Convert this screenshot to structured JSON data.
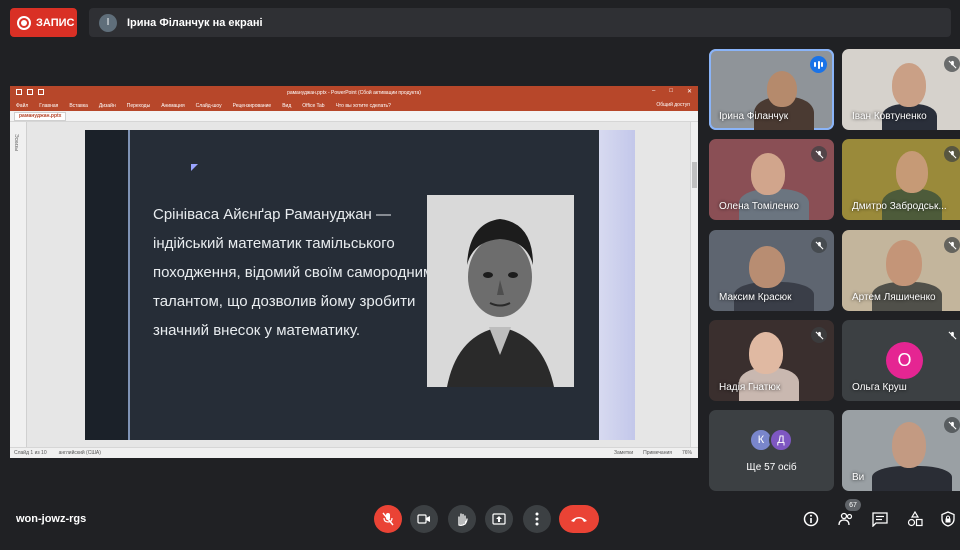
{
  "top": {
    "record_label": "ЗАПИС",
    "presenter_initial": "І",
    "presenting_text": "Ірина Філанчук на екрані"
  },
  "ppt": {
    "window_title": "рамануджан.pptx - PowerPoint (Сбой активации продукта)",
    "menu": [
      "Файл",
      "Главная",
      "Вставка",
      "Дизайн",
      "Переходы",
      "Анимация",
      "Слайд-шоу",
      "Рецензирование",
      "Вид",
      "Office Tab",
      "Что вы хотите сделать?"
    ],
    "share_label": "Общий доступ",
    "file_tab": "рамануджан.pptx",
    "side_label": "Эскизы",
    "status_slide": "Слайд 1 из 10",
    "status_lang": "английский (США)",
    "status_notes": "Заметки",
    "status_comments": "Примечания",
    "status_zoom": "76%"
  },
  "slide": {
    "text": "Срініваса Айєнґар Рамануджан — індійський математик тамільського походження, відомий своїм самородним талантом, що дозволив йому зробити значний внесок у математику."
  },
  "participants": [
    {
      "name": "Ірина Філанчук",
      "state": "speaking"
    },
    {
      "name": "Іван Ковтуненко",
      "state": "muted"
    },
    {
      "name": "Олена Томіленко",
      "state": "muted"
    },
    {
      "name": "Дмитро Забродськ...",
      "state": "muted"
    },
    {
      "name": "Максим Красюк",
      "state": "muted"
    },
    {
      "name": "Артем Ляшиченко",
      "state": "muted"
    },
    {
      "name": "Надія Гнатюк",
      "state": "muted"
    },
    {
      "name": "Ольга Круш",
      "state": "muted",
      "initial": "О"
    },
    {
      "name": "Ще 57 осіб",
      "initials": [
        "К",
        "Д"
      ]
    },
    {
      "name": "Ви",
      "state": "muted"
    }
  ],
  "bottom": {
    "meeting_code": "won-jowz-rgs",
    "people_count": "67"
  },
  "colors": {
    "background": "#202124",
    "record": "#d93025",
    "end_call": "#ea4335",
    "speaking_outline": "#8ab4f8",
    "powerpoint": "#b7472a"
  }
}
